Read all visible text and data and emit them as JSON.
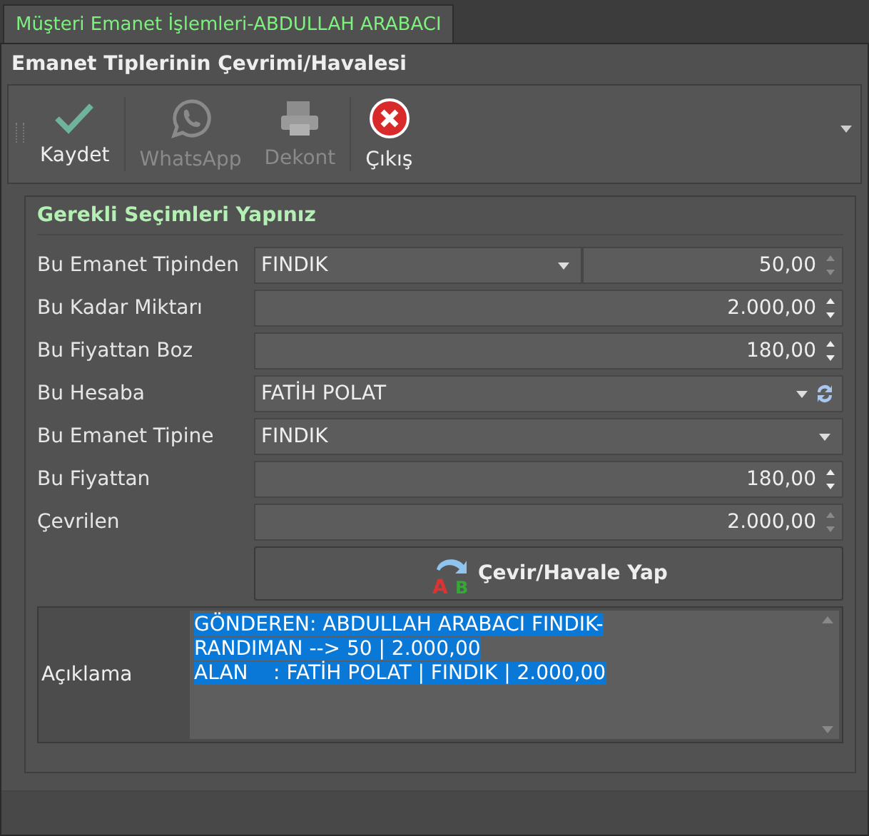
{
  "tab": {
    "label": "Müşteri Emanet İşlemleri-ABDULLAH ARABACI",
    "selected": true
  },
  "title": "Emanet Tiplerinin Çevrimi/Havalesi",
  "toolbar": [
    {
      "kind": "check",
      "label": "Kaydet",
      "disabled": false
    },
    {
      "kind": "whatsapp",
      "label": "WhatsApp",
      "disabled": true
    },
    {
      "kind": "printer",
      "label": "Dekont",
      "disabled": true
    },
    {
      "kind": "close",
      "label": "Çıkış",
      "disabled": false
    }
  ],
  "group": {
    "title": "Gerekli Seçimleri Yapınız",
    "rows": [
      {
        "kind": "combo-spin",
        "label": "Bu Emanet Tipinden",
        "value": "FINDIK",
        "number": "50,00",
        "spin_disabled": true
      },
      {
        "kind": "spin",
        "label": "Bu Kadar Miktarı",
        "number": "2.000,00",
        "spin_disabled": false
      },
      {
        "kind": "spin",
        "label": "Bu Fiyattan Boz",
        "number": "180,00",
        "spin_disabled": false
      },
      {
        "kind": "combo-refresh",
        "label": "Bu Hesaba",
        "value": "FATİH POLAT"
      },
      {
        "kind": "combo",
        "label": "Bu Emanet Tipine",
        "value": "FINDIK"
      },
      {
        "kind": "spin",
        "label": "Bu Fiyattan",
        "number": "180,00",
        "spin_disabled": false
      },
      {
        "kind": "spin",
        "label": "Çevrilen",
        "number": "2.000,00",
        "spin_disabled": true
      }
    ],
    "action_button": "Çevir/Havale Yap",
    "action_icon_letters": [
      "A",
      "B"
    ],
    "note": {
      "label": "Açıklama",
      "lines": [
        {
          "text": "GÖNDEREN: ABDULLAH ARABACI FINDIK-",
          "selected": true
        },
        {
          "text": "RANDIMAN --> 50 | 2.000,00",
          "selected": true
        },
        {
          "text": "ALAN    : FATİH POLAT | FINDIK | 2.000,00",
          "selected": true
        }
      ]
    }
  }
}
